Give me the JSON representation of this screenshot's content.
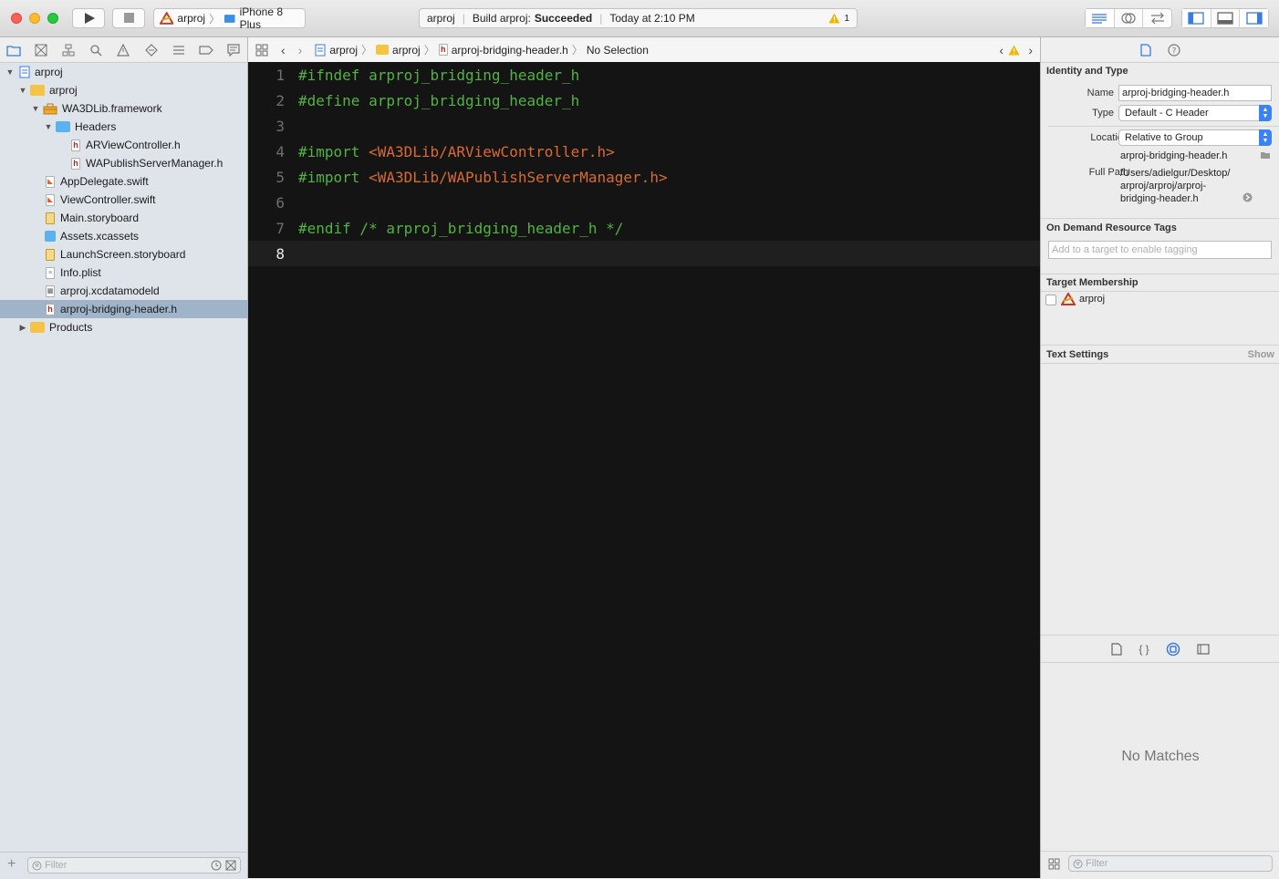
{
  "toolbar": {
    "scheme_project": "arproj",
    "scheme_device": "iPhone 8 Plus",
    "activity_project": "arproj",
    "activity_build_prefix": "Build arproj:",
    "activity_build_status": "Succeeded",
    "activity_time": "Today at 2:10 PM",
    "activity_warning_count": "1"
  },
  "navigator": {
    "items": [
      {
        "label": "arproj"
      },
      {
        "label": "arproj"
      },
      {
        "label": "WA3DLib.framework"
      },
      {
        "label": "Headers"
      },
      {
        "label": "ARViewController.h"
      },
      {
        "label": "WAPublishServerManager.h"
      },
      {
        "label": "AppDelegate.swift"
      },
      {
        "label": "ViewController.swift"
      },
      {
        "label": "Main.storyboard"
      },
      {
        "label": "Assets.xcassets"
      },
      {
        "label": "LaunchScreen.storyboard"
      },
      {
        "label": "Info.plist"
      },
      {
        "label": "arproj.xcdatamodeld"
      },
      {
        "label": "arproj-bridging-header.h"
      },
      {
        "label": "Products"
      }
    ],
    "filter_placeholder": "Filter"
  },
  "jumpbar": {
    "crumb_1": "arproj",
    "crumb_2": "arproj",
    "crumb_3": "arproj-bridging-header.h",
    "crumb_4": "No Selection"
  },
  "editor": {
    "lines": [
      {
        "num": "1",
        "kw": "#ifndef arproj_bridging_header_h",
        "str": ""
      },
      {
        "num": "2",
        "kw": "#define arproj_bridging_header_h",
        "str": ""
      },
      {
        "num": "3",
        "kw": "",
        "str": ""
      },
      {
        "num": "4",
        "kw": "#import ",
        "str": "<WA3DLib/ARViewController.h>"
      },
      {
        "num": "5",
        "kw": "#import ",
        "str": "<WA3DLib/WAPublishServerManager.h>"
      },
      {
        "num": "6",
        "kw": "",
        "str": ""
      },
      {
        "num": "7",
        "kw": "#endif /* arproj_bridging_header_h */",
        "str": ""
      },
      {
        "num": "8",
        "kw": "",
        "str": ""
      }
    ]
  },
  "inspector": {
    "identity_title": "Identity and Type",
    "name_label": "Name",
    "name_value": "arproj-bridging-header.h",
    "type_label": "Type",
    "type_value": "Default - C Header",
    "location_label": "Location",
    "location_value": "Relative to Group",
    "location_file": "arproj-bridging-header.h",
    "fullpath_label": "Full Path",
    "fullpath_line1": "/Users/adielgur/Desktop/",
    "fullpath_line2": "arproj/arproj/arproj-",
    "fullpath_line3": "bridging-header.h",
    "odr_title": "On Demand Resource Tags",
    "odr_placeholder": "Add to a target to enable tagging",
    "target_title": "Target Membership",
    "target_name": "arproj",
    "text_settings_title": "Text Settings",
    "text_settings_show": "Show",
    "library_empty": "No Matches",
    "library_filter_placeholder": "Filter"
  }
}
